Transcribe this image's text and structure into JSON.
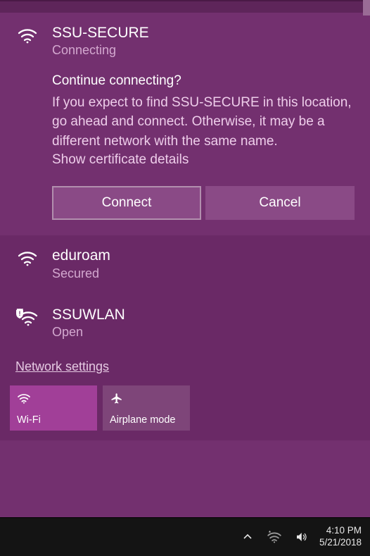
{
  "networks": [
    {
      "name": "SSU-SECURE",
      "status": "Connecting",
      "expanded": true,
      "icon": "wifi-secure",
      "prompt": {
        "title": "Continue connecting?",
        "body": "If you expect to find SSU-SECURE in this location, go ahead and connect. Otherwise, it may be a different network with the same name.",
        "cert_link": "Show certificate details",
        "connect_label": "Connect",
        "cancel_label": "Cancel"
      }
    },
    {
      "name": "eduroam",
      "status": "Secured",
      "expanded": false,
      "icon": "wifi-secure"
    },
    {
      "name": "SSUWLAN",
      "status": "Open",
      "expanded": false,
      "icon": "wifi-open-warn"
    }
  ],
  "settings_link": "Network settings",
  "tiles": {
    "wifi": {
      "label": "Wi-Fi",
      "active": true
    },
    "airplane": {
      "label": "Airplane mode",
      "active": false
    }
  },
  "taskbar": {
    "time": "4:10 PM",
    "date": "5/21/2018"
  }
}
